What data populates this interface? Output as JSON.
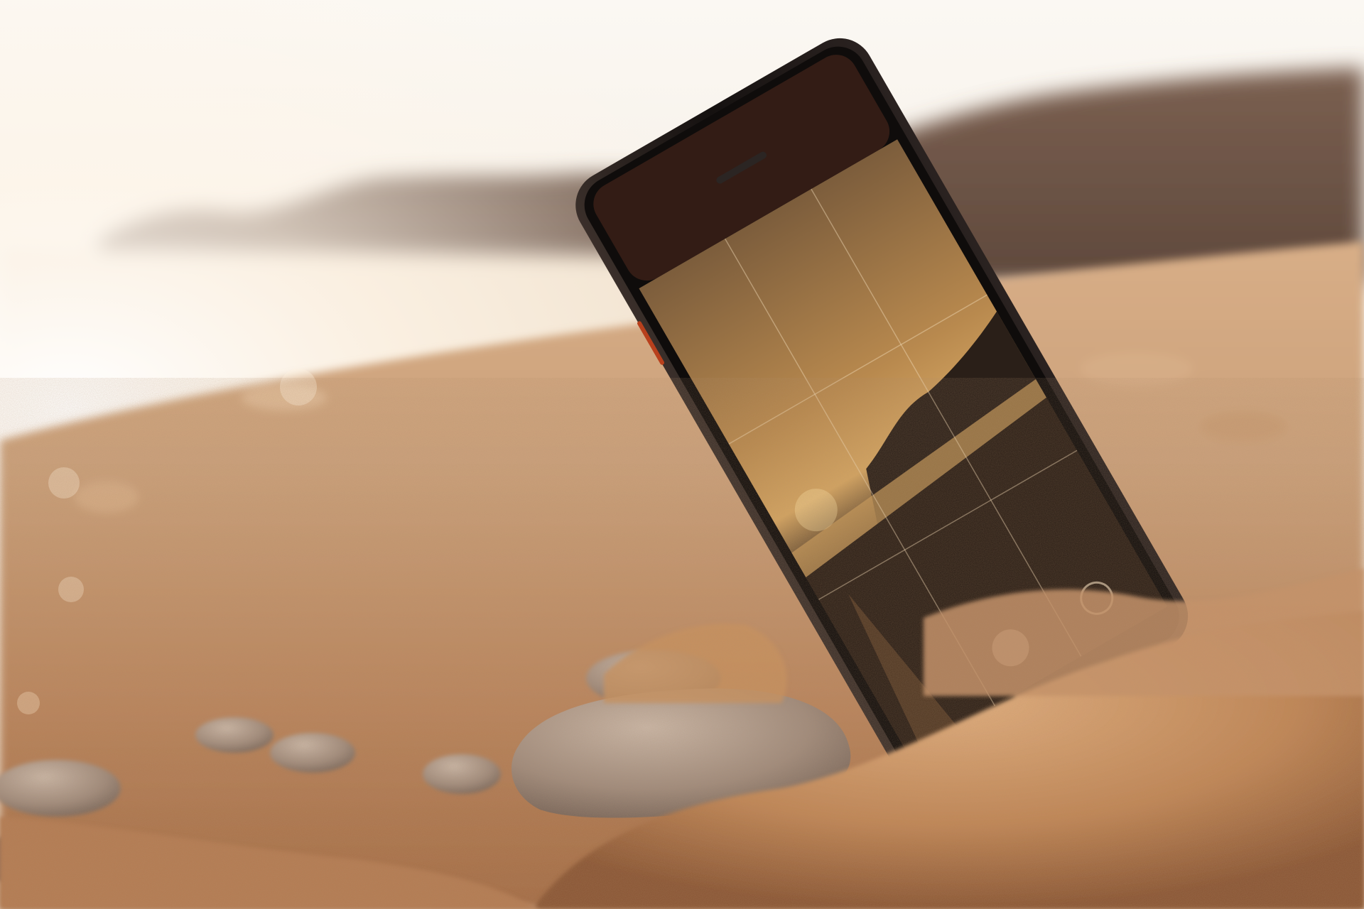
{
  "scene": {
    "description_name": "phone-in-beach-sand-at-sunset",
    "colors": {
      "sky_bright": "#fbf7f1",
      "sky_warm": "#eadbc8",
      "hills": "#6f5646",
      "hills_far": "#8c6f5b",
      "sea": "#e9d6bf",
      "sand_light": "#e2b88c",
      "sand_mid": "#c8926a",
      "sand_dark": "#8e5a3a",
      "pebble": "#9c8b80",
      "phone_body": "#1c1715",
      "phone_accent": "#b8401c"
    },
    "phone_screen": {
      "content_name": "camera-viewfinder-preview",
      "grid_visible": true
    }
  }
}
